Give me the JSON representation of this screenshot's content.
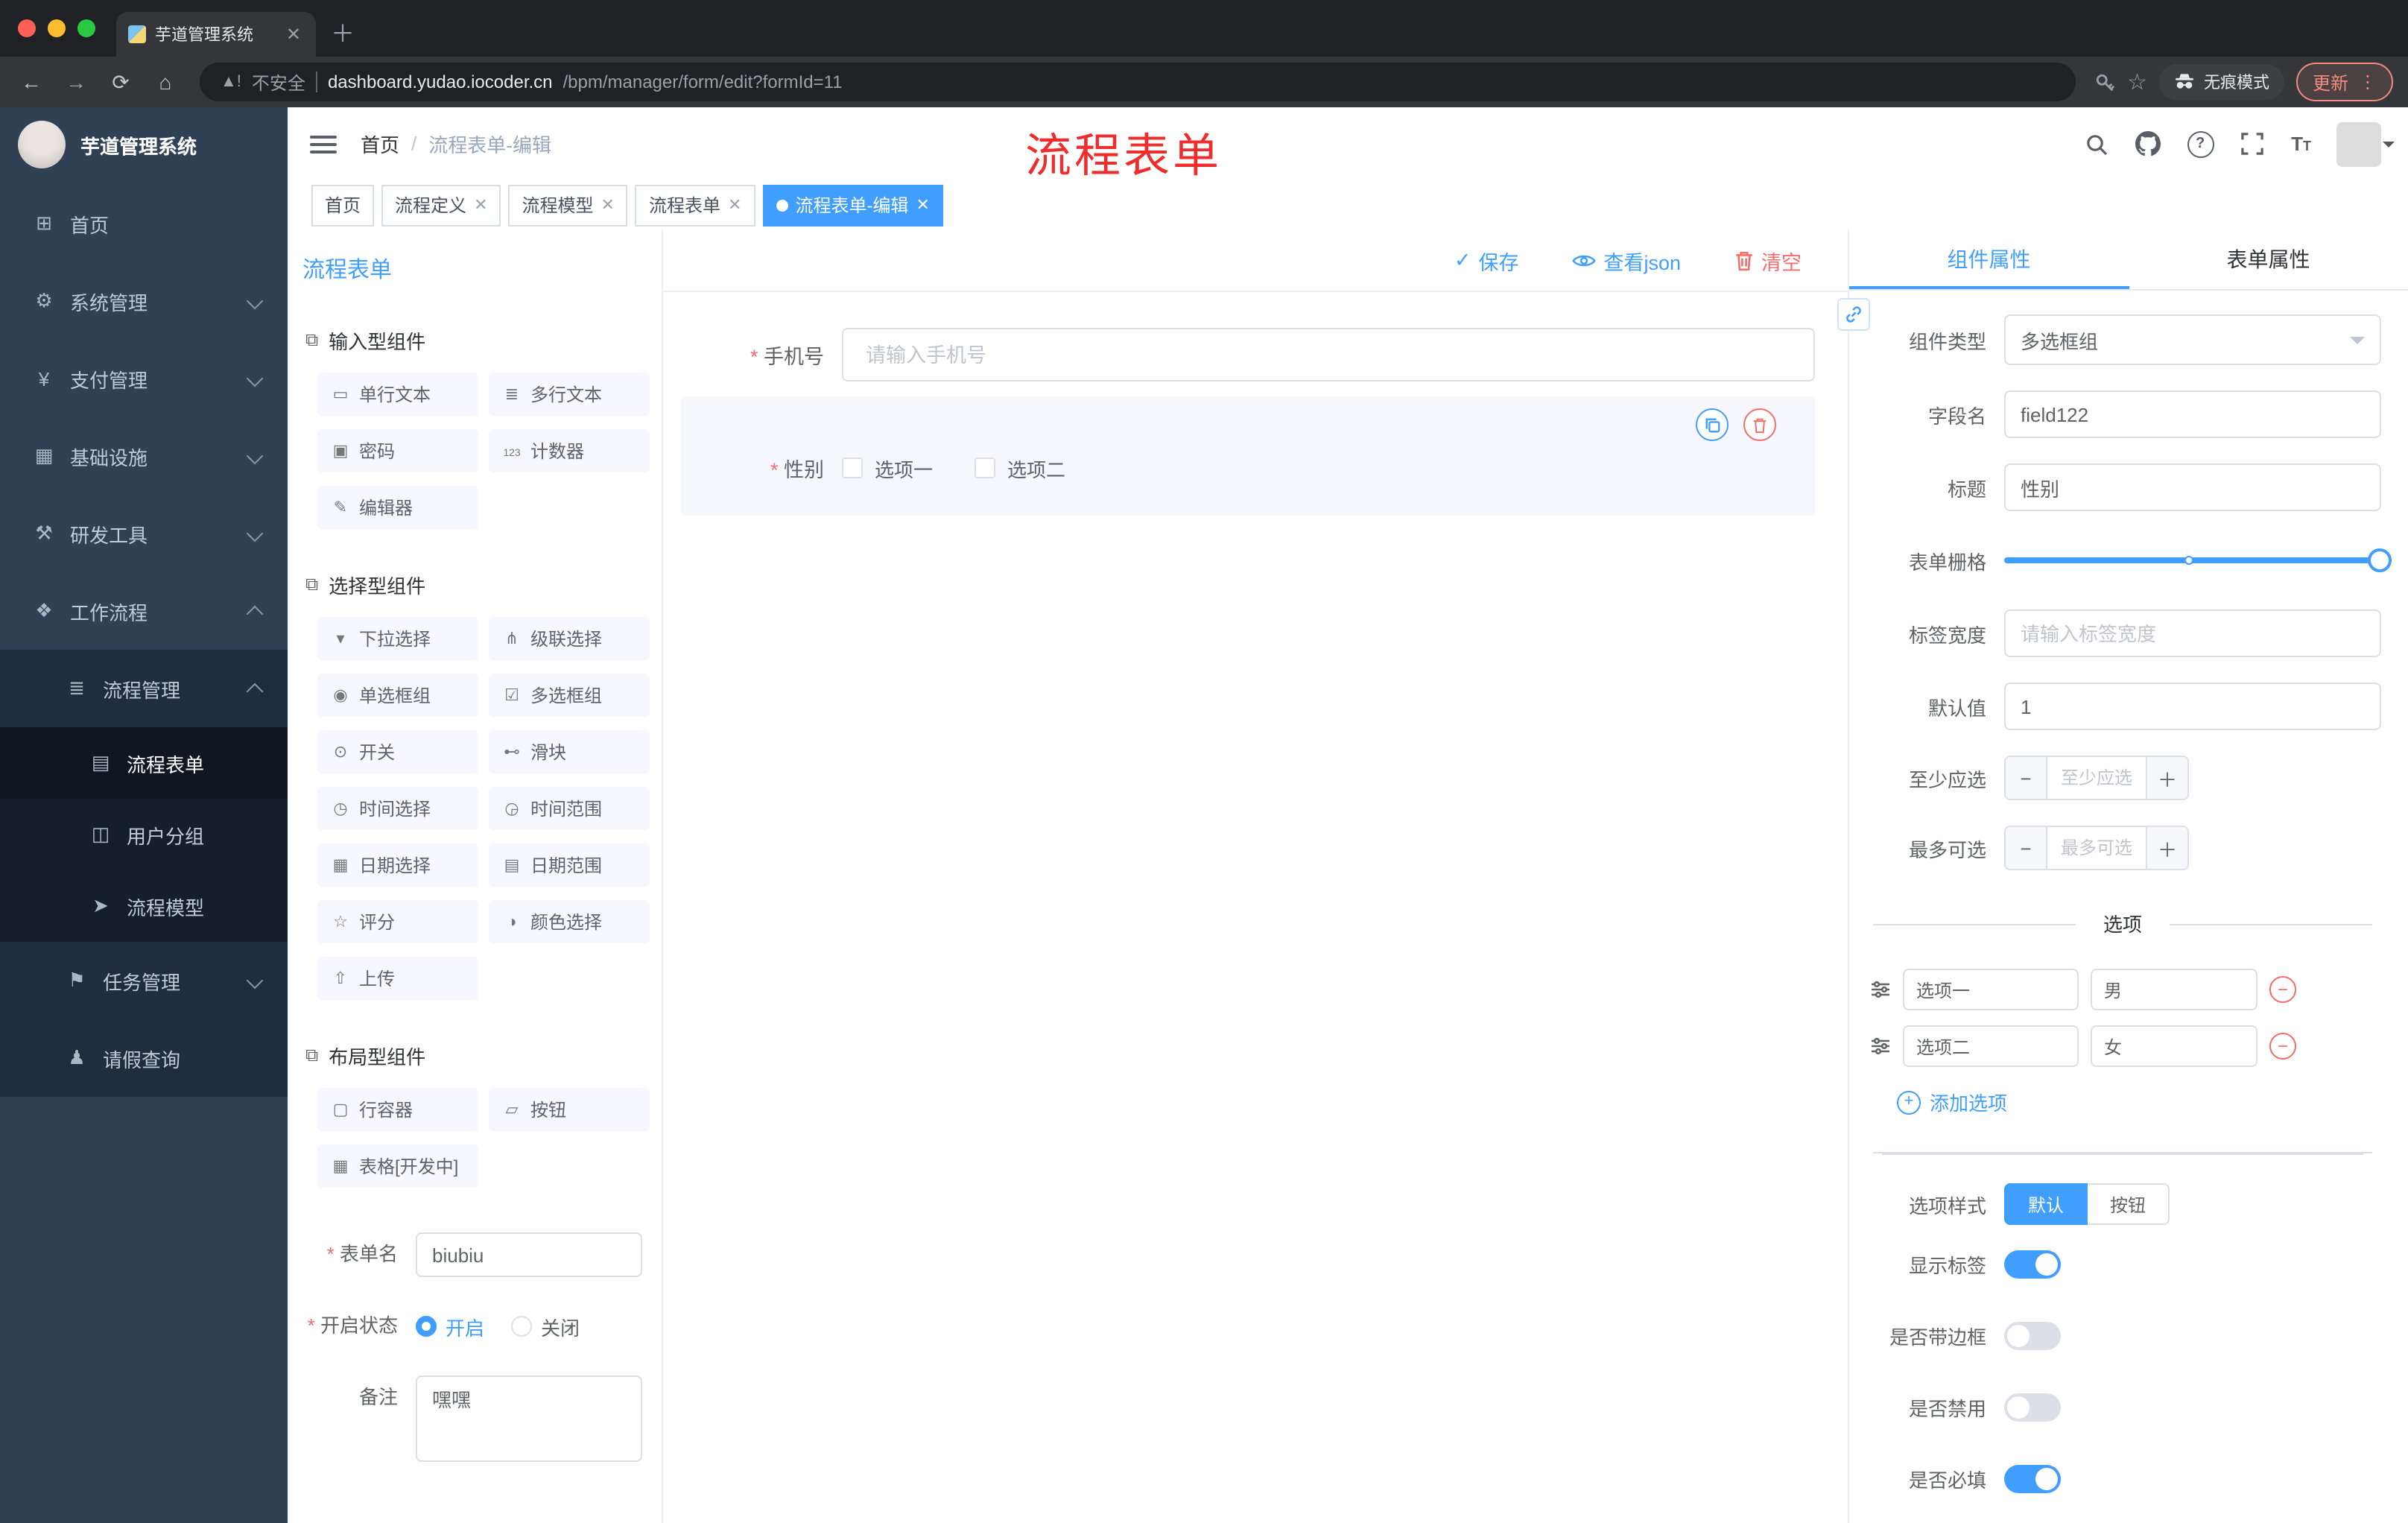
{
  "colors": {
    "primary": "#409eff",
    "danger": "#f56c6c",
    "annotation": "#f02d2d",
    "sidebar_bg": "#304156",
    "active_tag_bg": "#409eff"
  },
  "browser": {
    "tab": {
      "title": "芋道管理系统"
    },
    "address": {
      "security": "不安全",
      "host": "dashboard.yudao.iocoder.cn",
      "path": "/bpm/manager/form/edit?formId=11"
    },
    "incognito": "无痕模式",
    "update": "更新"
  },
  "sidebar": {
    "logo": "芋道管理系统",
    "items": [
      {
        "label": "首页"
      },
      {
        "label": "系统管理"
      },
      {
        "label": "支付管理"
      },
      {
        "label": "基础设施"
      },
      {
        "label": "研发工具"
      },
      {
        "label": "工作流程"
      },
      {
        "label": "流程管理"
      },
      {
        "label": "流程表单"
      },
      {
        "label": "用户分组"
      },
      {
        "label": "流程模型"
      },
      {
        "label": "任务管理"
      },
      {
        "label": "请假查询"
      }
    ]
  },
  "header": {
    "breadcrumb_home": "首页",
    "breadcrumb_current": "流程表单-编辑",
    "annotation": "流程表单"
  },
  "tags": {
    "home": "首页",
    "t1": "流程定义",
    "t2": "流程模型",
    "t3": "流程表单",
    "active": "流程表单-编辑"
  },
  "designer": {
    "title": "流程表单",
    "groups": [
      {
        "title": "输入型组件",
        "items": [
          "单行文本",
          "多行文本",
          "密码",
          "计数器",
          "编辑器"
        ]
      },
      {
        "title": "选择型组件",
        "items": [
          "下拉选择",
          "级联选择",
          "单选框组",
          "多选框组",
          "开关",
          "滑块",
          "时间选择",
          "时间范围",
          "日期选择",
          "日期范围",
          "评分",
          "颜色选择",
          "上传"
        ]
      },
      {
        "title": "布局型组件",
        "items": [
          "行容器",
          "按钮",
          "表格[开发中]"
        ]
      }
    ],
    "form": {
      "name_label": "表单名",
      "name_value": "biubiu",
      "status_label": "开启状态",
      "status_on": "开启",
      "status_off": "关闭",
      "remark_label": "备注",
      "remark_value": "嘿嘿"
    }
  },
  "canvas": {
    "save": "保存",
    "view_json": "查看json",
    "clear": "清空",
    "phone": {
      "label": "手机号",
      "placeholder": "请输入手机号"
    },
    "gender": {
      "label": "性别",
      "option1": "选项一",
      "option2": "选项二"
    }
  },
  "props": {
    "tab_component": "组件属性",
    "tab_form": "表单属性",
    "component_type_label": "组件类型",
    "component_type_value": "多选框组",
    "field_label": "字段名",
    "field_value": "field122",
    "title_label": "标题",
    "title_value": "性别",
    "grid_label": "表单栅格",
    "label_width_label": "标签宽度",
    "label_width_placeholder": "请输入标签宽度",
    "default_label": "默认值",
    "default_value": "1",
    "min_label": "至少应选",
    "min_placeholder": "至少应选",
    "max_label": "最多可选",
    "max_placeholder": "最多可选",
    "options_title": "选项",
    "options": [
      {
        "label": "选项一",
        "value": "男"
      },
      {
        "label": "选项二",
        "value": "女"
      }
    ],
    "add_option": "添加选项",
    "style_label": "选项样式",
    "style_default": "默认",
    "style_button": "按钮",
    "switch_show_label": "显示标签",
    "switch_border": "是否带边框",
    "switch_disabled": "是否禁用",
    "switch_required": "是否必填"
  }
}
